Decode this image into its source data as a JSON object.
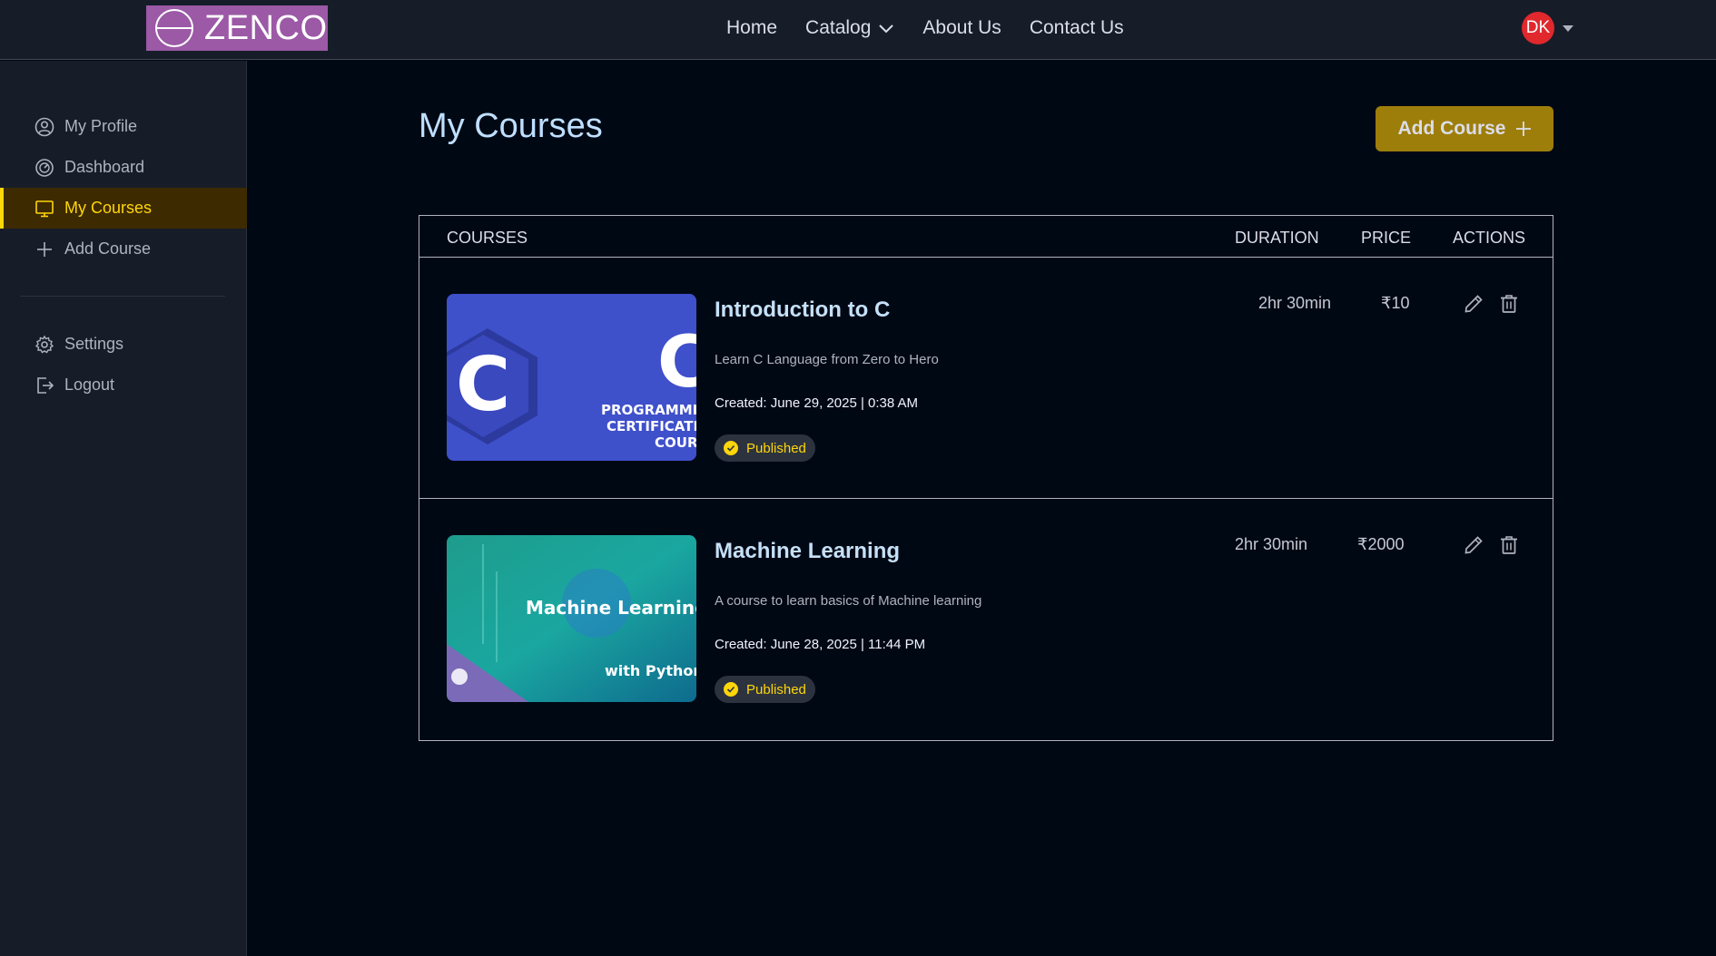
{
  "brand": {
    "logo_text": "ZENCO"
  },
  "nav": {
    "links": [
      "Home",
      "Catalog",
      "About Us",
      "Contact Us"
    ],
    "user_initials": "DK"
  },
  "sidebar": {
    "items": [
      {
        "label": "My Profile",
        "icon": "user-circle-icon"
      },
      {
        "label": "Dashboard",
        "icon": "gauge-icon"
      },
      {
        "label": "My Courses",
        "icon": "monitor-icon",
        "active": true
      },
      {
        "label": "Add Course",
        "icon": "plus-icon"
      }
    ],
    "bottom_items": [
      {
        "label": "Settings",
        "icon": "gear-icon"
      },
      {
        "label": "Logout",
        "icon": "logout-icon"
      }
    ]
  },
  "main": {
    "title": "My Courses",
    "add_button": "Add Course"
  },
  "table": {
    "headers": {
      "courses": "COURSES",
      "duration": "DURATION",
      "price": "PRICE",
      "actions": "ACTIONS"
    },
    "rows": [
      {
        "title": "Introduction to C",
        "description": "Learn C Language from Zero to Hero",
        "created": "Created: June 29, 2025 | 0:38 AM",
        "status": "Published",
        "duration": "2hr 30min",
        "price": "₹10",
        "thumb_letter": "C",
        "thumb_big_letter": "C",
        "thumb_line1": "PROGRAMMIN",
        "thumb_line2": "CERTIFICATIO",
        "thumb_line3": "COUR"
      },
      {
        "title": "Machine Learning",
        "description": "A course to learn basics of Machine learning",
        "created": "Created: June 28, 2025 | 11:44 PM",
        "status": "Published",
        "duration": "2hr 30min",
        "price": "₹2000",
        "thumb_line1": "Machine Learning",
        "thumb_line2": "with Python"
      }
    ]
  },
  "colors": {
    "page_bg": "#000814",
    "panel_bg": "#161D29",
    "accent_yellow": "#FFD60A",
    "button_yellow": "#9E7E0A",
    "title_blue": "#BFDFFF",
    "avatar_red": "#E0282D",
    "logo_purple": "#9B59A6"
  }
}
